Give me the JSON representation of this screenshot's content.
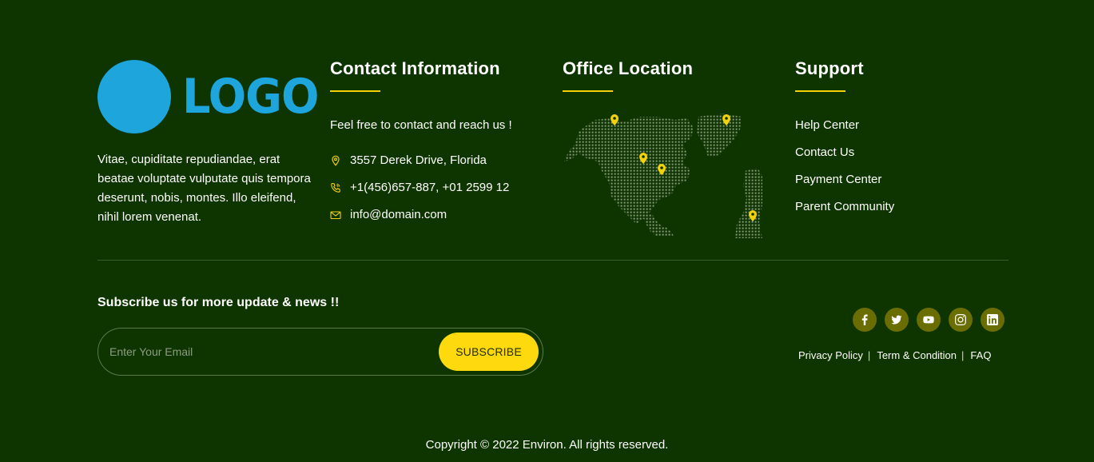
{
  "brand": {
    "logo_text": "LOGO",
    "logo_color": "#1ea5dc",
    "description": "Vitae, cupiditate repudiandae, erat beatae voluptate vulputate quis tempora deserunt, nobis, montes. Illo eleifend, nihil lorem venenat."
  },
  "contact": {
    "heading": "Contact Information",
    "intro": "Feel free to contact and reach us !",
    "address": "3557 Derek Drive, Florida",
    "phone": "+1(456)657-887, +01 2599 12",
    "email": "info@domain.com",
    "icons": [
      "map-pin-icon",
      "phone-icon",
      "mail-icon"
    ]
  },
  "office": {
    "heading": "Office Location",
    "map_icon": "world-map-icon",
    "pin_icon": "map-marker-icon"
  },
  "support": {
    "heading": "Support",
    "links": [
      "Help Center",
      "Contact Us",
      "Payment Center",
      "Parent Community"
    ]
  },
  "subscribe": {
    "title": "Subscribe us for more update & news !!",
    "placeholder": "Enter Your Email",
    "button": "SUBSCRIBE"
  },
  "socials": [
    "facebook-icon",
    "twitter-icon",
    "youtube-icon",
    "instagram-icon",
    "linkedin-icon"
  ],
  "legal": {
    "privacy": "Privacy Policy",
    "terms": "Term & Condition",
    "faq": "FAQ",
    "separator": "|"
  },
  "copyright": "Copyright © 2022 Environ. All rights reserved.",
  "colors": {
    "background": "#0e3500",
    "accent": "#f5d10a",
    "button": "#fdd90d",
    "social_bg": "#6a6e00"
  }
}
